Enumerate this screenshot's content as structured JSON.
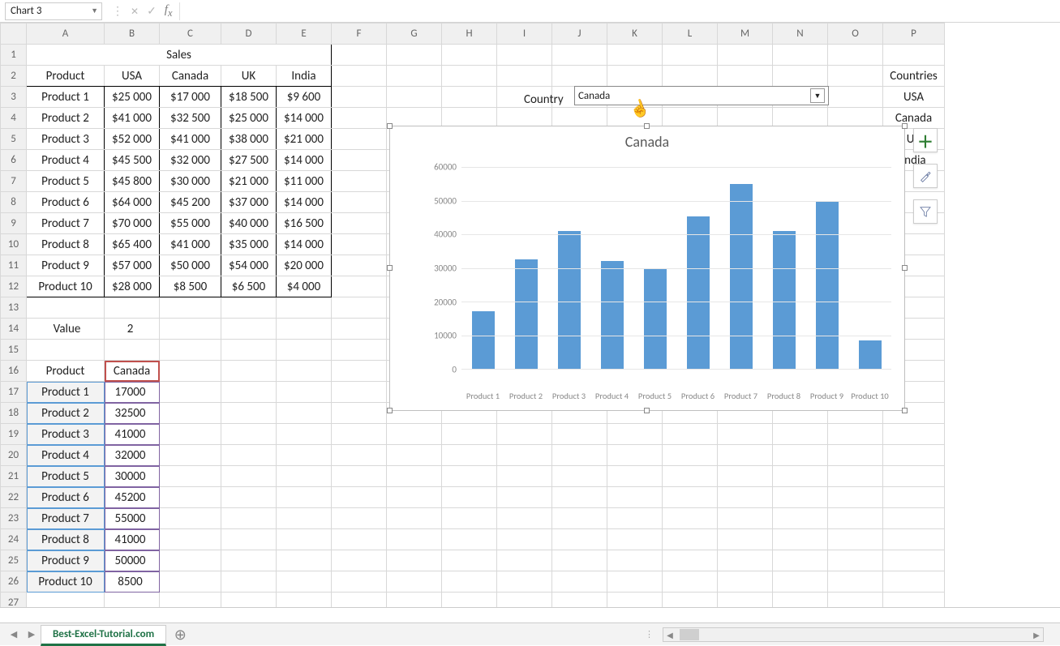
{
  "name_box": "Chart 3",
  "sheet_tab": "Best-Excel-Tutorial.com",
  "columns": [
    "A",
    "B",
    "C",
    "D",
    "E",
    "F",
    "G",
    "H",
    "I",
    "J",
    "K",
    "L",
    "M",
    "N",
    "O",
    "P"
  ],
  "rows": [
    1,
    2,
    3,
    4,
    5,
    6,
    7,
    8,
    9,
    10,
    11,
    12,
    13,
    14,
    15,
    16,
    17,
    18,
    19,
    20,
    21,
    22,
    23,
    24,
    25,
    26,
    27
  ],
  "title_cell": "Sales",
  "headers": {
    "product": "Product",
    "usa": "USA",
    "canada": "Canada",
    "uk": "UK",
    "india": "India"
  },
  "sales": [
    {
      "product": "Product 1",
      "usa": "$25 000",
      "canada": "$17 000",
      "uk": "$18 500",
      "india": "$9 600"
    },
    {
      "product": "Product 2",
      "usa": "$41 000",
      "canada": "$32 500",
      "uk": "$25 000",
      "india": "$14 000"
    },
    {
      "product": "Product 3",
      "usa": "$52 000",
      "canada": "$41 000",
      "uk": "$38 000",
      "india": "$21 000"
    },
    {
      "product": "Product 4",
      "usa": "$45 500",
      "canada": "$32 000",
      "uk": "$27 500",
      "india": "$14 000"
    },
    {
      "product": "Product 5",
      "usa": "$45 800",
      "canada": "$30 000",
      "uk": "$21 000",
      "india": "$11 000"
    },
    {
      "product": "Product 6",
      "usa": "$64 000",
      "canada": "$45 200",
      "uk": "$37 000",
      "india": "$14 000"
    },
    {
      "product": "Product 7",
      "usa": "$70 000",
      "canada": "$55 000",
      "uk": "$40 000",
      "india": "$16 500"
    },
    {
      "product": "Product 8",
      "usa": "$65 400",
      "canada": "$41 000",
      "uk": "$35 000",
      "india": "$14 000"
    },
    {
      "product": "Product 9",
      "usa": "$57 000",
      "canada": "$50 000",
      "uk": "$54 000",
      "india": "$20 000"
    },
    {
      "product": "Product 10",
      "usa": "$28 000",
      "canada": "$8 500",
      "uk": "$6 500",
      "india": "$4 000"
    }
  ],
  "value_row": {
    "label": "Value",
    "val": "2"
  },
  "lookup_hdr": {
    "a": "Product",
    "b": "Canada"
  },
  "lookup": [
    {
      "p": "Product 1",
      "v": "17000"
    },
    {
      "p": "Product 2",
      "v": "32500"
    },
    {
      "p": "Product 3",
      "v": "41000"
    },
    {
      "p": "Product 4",
      "v": "32000"
    },
    {
      "p": "Product 5",
      "v": "30000"
    },
    {
      "p": "Product 6",
      "v": "45200"
    },
    {
      "p": "Product 7",
      "v": "55000"
    },
    {
      "p": "Product 8",
      "v": "41000"
    },
    {
      "p": "Product 9",
      "v": "50000"
    },
    {
      "p": "Product 10",
      "v": "8500"
    }
  ],
  "country_label": "Country",
  "country_selected": "Canada",
  "countries_hdr": "Countries",
  "countries": [
    "USA",
    "Canada",
    "UK",
    "India"
  ],
  "chart_data": {
    "type": "bar",
    "title": "Canada",
    "categories": [
      "Product 1",
      "Product 2",
      "Product 3",
      "Product 4",
      "Product 5",
      "Product 6",
      "Product 7",
      "Product 8",
      "Product 9",
      "Product 10"
    ],
    "values": [
      17000,
      32500,
      41000,
      32000,
      30000,
      45200,
      55000,
      41000,
      50000,
      8500
    ],
    "ylim": [
      0,
      60000
    ],
    "yticks": [
      0,
      10000,
      20000,
      30000,
      40000,
      50000,
      60000
    ]
  }
}
